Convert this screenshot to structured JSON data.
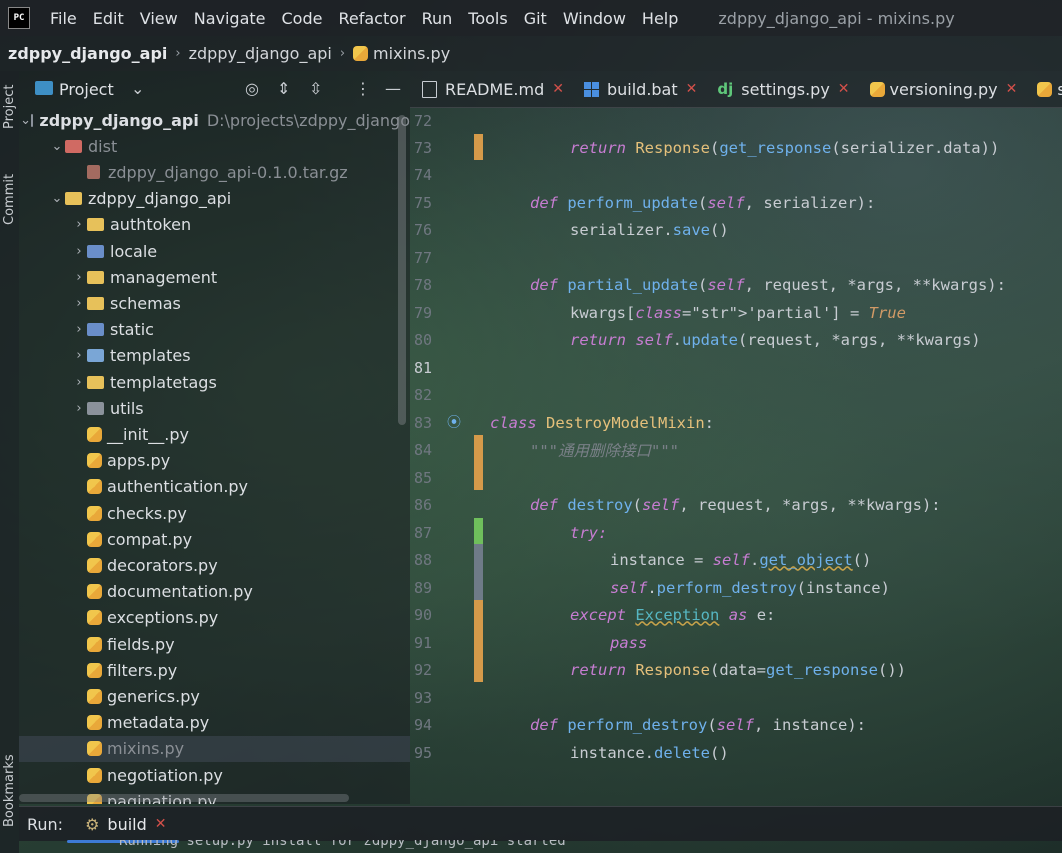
{
  "menubar": {
    "logo": "PC",
    "items": [
      "File",
      "Edit",
      "View",
      "Navigate",
      "Code",
      "Refactor",
      "Run",
      "Tools",
      "Git",
      "Window",
      "Help"
    ],
    "window_title": "zdppy_django_api - mixins.py"
  },
  "breadcrumb": {
    "root": "zdppy_django_api",
    "folder": "zdppy_django_api",
    "file": "mixins.py"
  },
  "sidebar": {
    "project_tab": "Project",
    "commit_tab": "Commit",
    "bookmarks_tab": "Bookmarks"
  },
  "project_panel": {
    "title": "Project",
    "tree": [
      {
        "label": "zdppy_django_api",
        "hint": "D:\\projects\\zdppy_django",
        "level": 0,
        "type": "root",
        "expanded": true
      },
      {
        "label": "dist",
        "level": 1,
        "type": "folder-red",
        "expanded": true
      },
      {
        "label": "zdppy_django_api-0.1.0.tar.gz",
        "level": 2,
        "type": "gz"
      },
      {
        "label": "zdppy_django_api",
        "level": 1,
        "type": "folder",
        "expanded": true
      },
      {
        "label": "authtoken",
        "level": 2,
        "type": "folder",
        "expanded": false
      },
      {
        "label": "locale",
        "level": 2,
        "type": "folder-blue",
        "expanded": false
      },
      {
        "label": "management",
        "level": 2,
        "type": "folder",
        "expanded": false
      },
      {
        "label": "schemas",
        "level": 2,
        "type": "folder-pink",
        "expanded": false
      },
      {
        "label": "static",
        "level": 2,
        "type": "folder-blue",
        "expanded": false
      },
      {
        "label": "templates",
        "level": 2,
        "type": "folder-img",
        "expanded": false
      },
      {
        "label": "templatetags",
        "level": 2,
        "type": "folder",
        "expanded": false
      },
      {
        "label": "utils",
        "level": 2,
        "type": "folder-grey",
        "expanded": false
      },
      {
        "label": "__init__.py",
        "level": 2,
        "type": "py"
      },
      {
        "label": "apps.py",
        "level": 2,
        "type": "py"
      },
      {
        "label": "authentication.py",
        "level": 2,
        "type": "py"
      },
      {
        "label": "checks.py",
        "level": 2,
        "type": "py"
      },
      {
        "label": "compat.py",
        "level": 2,
        "type": "py"
      },
      {
        "label": "decorators.py",
        "level": 2,
        "type": "py"
      },
      {
        "label": "documentation.py",
        "level": 2,
        "type": "py"
      },
      {
        "label": "exceptions.py",
        "level": 2,
        "type": "py"
      },
      {
        "label": "fields.py",
        "level": 2,
        "type": "py"
      },
      {
        "label": "filters.py",
        "level": 2,
        "type": "py"
      },
      {
        "label": "generics.py",
        "level": 2,
        "type": "py"
      },
      {
        "label": "metadata.py",
        "level": 2,
        "type": "py"
      },
      {
        "label": "mixins.py",
        "level": 2,
        "type": "py",
        "selected": true
      },
      {
        "label": "negotiation.py",
        "level": 2,
        "type": "py"
      },
      {
        "label": "pagination.py",
        "level": 2,
        "type": "py"
      }
    ]
  },
  "editor_tabs": [
    {
      "label": "README.md",
      "icon": "markdown-icon"
    },
    {
      "label": "build.bat",
      "icon": "windows-icon"
    },
    {
      "label": "settings.py",
      "icon": "django-icon"
    },
    {
      "label": "versioning.py",
      "icon": "python-icon"
    },
    {
      "label": "seria",
      "icon": "python-icon"
    }
  ],
  "code_lines": [
    {
      "n": "72"
    },
    {
      "n": "73"
    },
    {
      "n": "74"
    },
    {
      "n": "75"
    },
    {
      "n": "76"
    },
    {
      "n": "77"
    },
    {
      "n": "78"
    },
    {
      "n": "79"
    },
    {
      "n": "80"
    },
    {
      "n": "81"
    },
    {
      "n": "82"
    },
    {
      "n": "83"
    },
    {
      "n": "84"
    },
    {
      "n": "85"
    },
    {
      "n": "86"
    },
    {
      "n": "87"
    },
    {
      "n": "88"
    },
    {
      "n": "89"
    },
    {
      "n": "90"
    },
    {
      "n": "91"
    },
    {
      "n": "92"
    },
    {
      "n": "93"
    },
    {
      "n": "94"
    },
    {
      "n": "95"
    }
  ],
  "code_text": {
    "l73": "return Response(get_response(serializer.data))",
    "l75": "def perform_update(self, serializer):",
    "l76": "serializer.save()",
    "l78": "def partial_update(self, request, *args, **kwargs):",
    "l79": "kwargs['partial'] = True",
    "l80": "return self.update(request, *args, **kwargs)",
    "l83": "class DestroyModelMixin:",
    "l84": "\"\"\"通用删除接口\"\"\"",
    "l86": "def destroy(self, request, *args, **kwargs):",
    "l87": "try:",
    "l88": "instance = self.get_object()",
    "l89": "self.perform_destroy(instance)",
    "l90": "except Exception as e:",
    "l91": "pass",
    "l92": "return Response(data=get_response())",
    "l94": "def perform_destroy(self, instance):",
    "l95": "instance.delete()"
  },
  "run_panel": {
    "label": "Run:",
    "tab": "build",
    "console": "Running setup.py install for zdppy_django_api started"
  },
  "colors": {
    "accent": "#3d7bd6",
    "close": "#d2504a",
    "keyword": "#c77dd2",
    "function": "#6fb1ec",
    "change_modified": "#d59a4a",
    "change_added": "#6fbf5c"
  }
}
